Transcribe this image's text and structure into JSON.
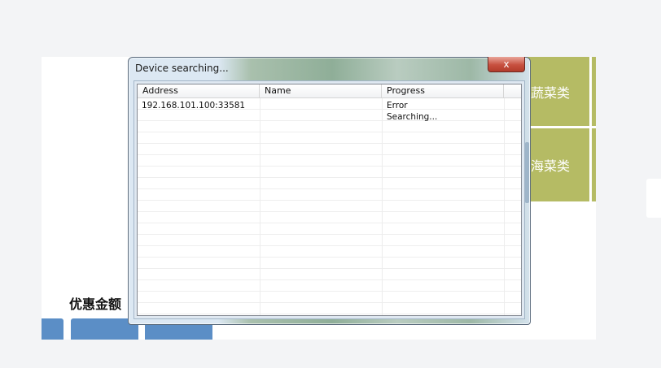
{
  "dialog": {
    "title": "Device searching...",
    "close_label": "x",
    "columns": [
      "Address",
      "Name",
      "Progress"
    ],
    "rows": [
      {
        "address": "192.168.101.100:33581",
        "name": "",
        "progress": "Error"
      },
      {
        "address": "",
        "name": "",
        "progress": "Searching..."
      }
    ]
  },
  "background": {
    "discount_label": "优惠金额",
    "tile_a_label": "蔬菜类",
    "tile_b_label": "海菜类",
    "button_labels": [
      "",
      "",
      ""
    ]
  },
  "colors": {
    "tile": "#b5bb64",
    "button": "#5b8ec6",
    "close_button": "#c7503f"
  }
}
